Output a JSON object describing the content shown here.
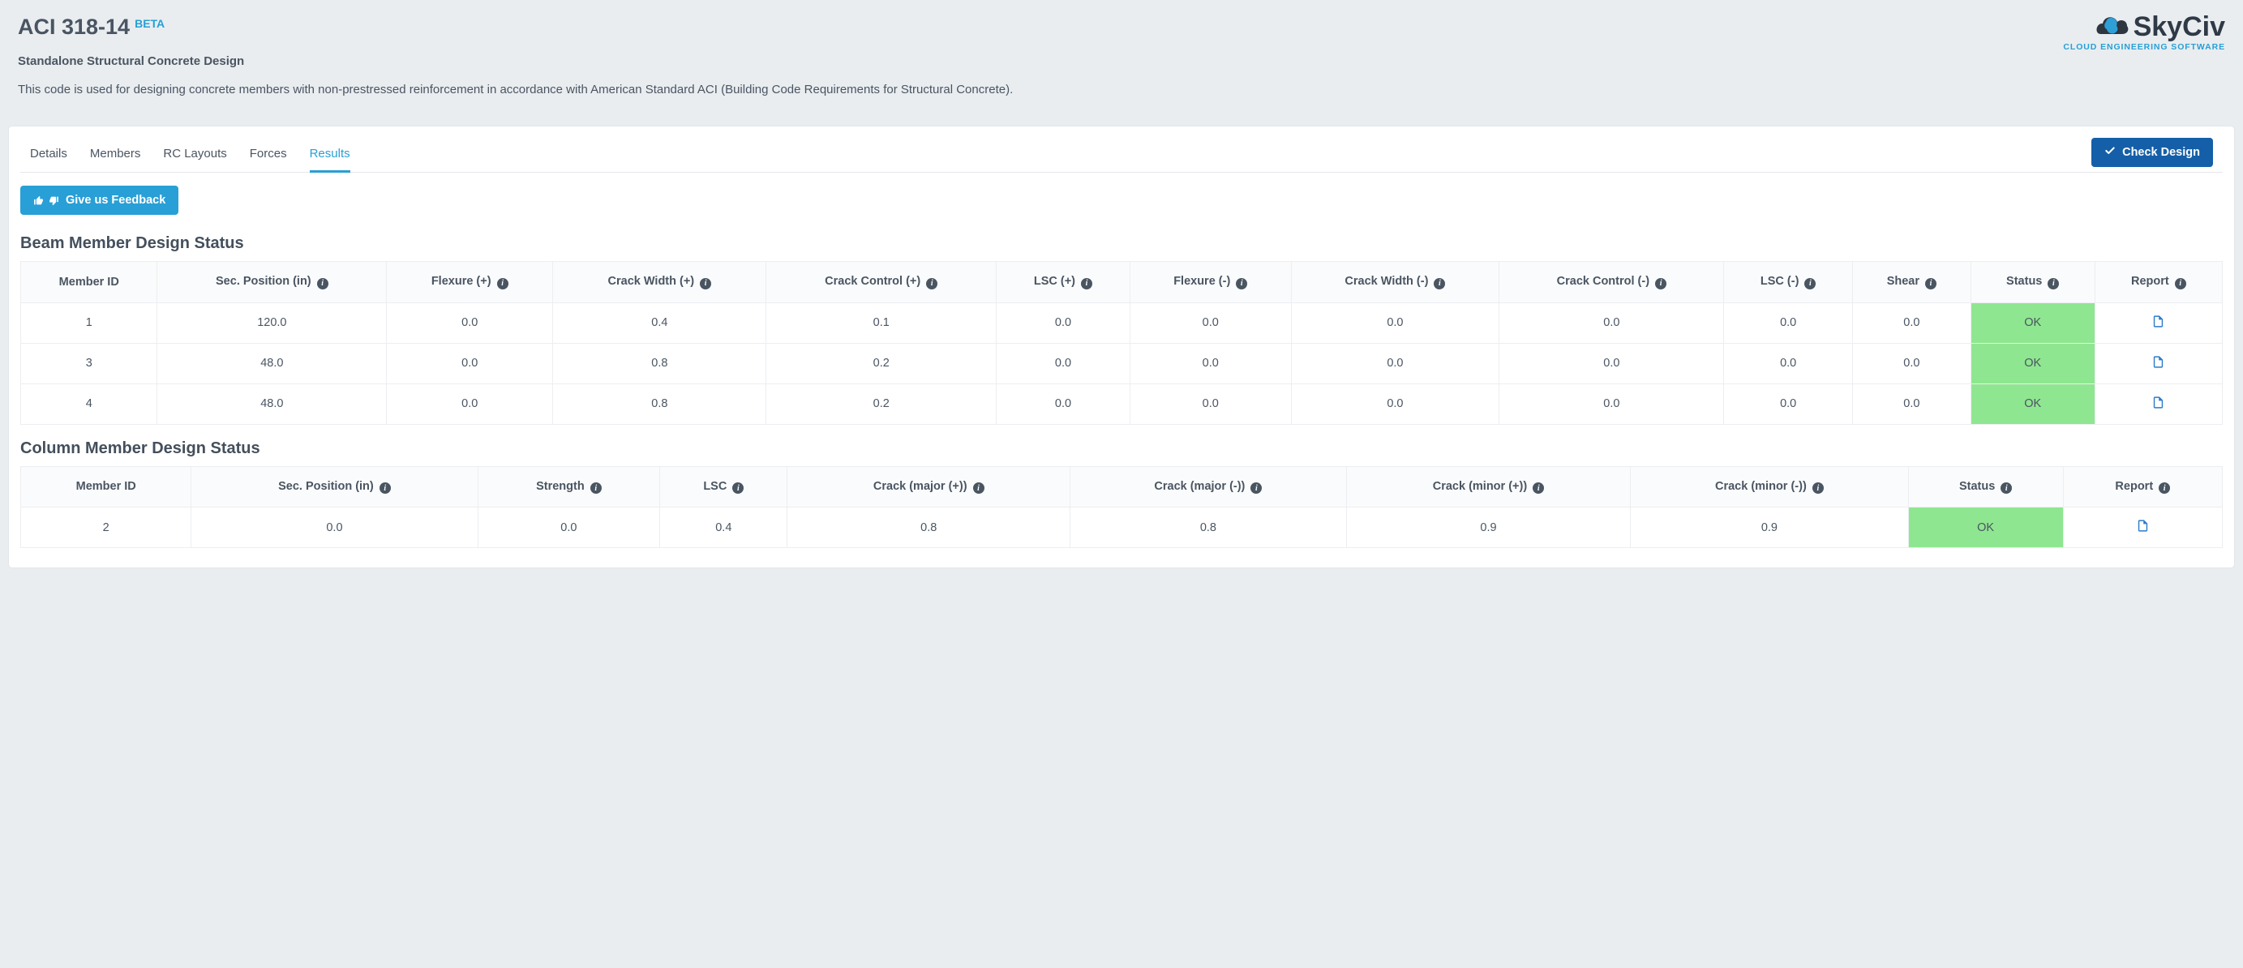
{
  "header": {
    "title": "ACI 318-14",
    "badge": "BETA",
    "subtitle": "Standalone Structural Concrete Design",
    "description": "This code is used for designing concrete members with non-prestressed reinforcement in accordance with American Standard ACI (Building Code Requirements for Structural Concrete).",
    "logo_text": "SkyCiv",
    "logo_subtext": "CLOUD ENGINEERING SOFTWARE"
  },
  "tabs": {
    "items": [
      "Details",
      "Members",
      "RC Layouts",
      "Forces",
      "Results"
    ],
    "active_index": 4
  },
  "buttons": {
    "check_design": "Check Design",
    "feedback": "Give us Feedback"
  },
  "beam_table": {
    "title": "Beam Member Design Status",
    "columns": [
      "Member ID",
      "Sec. Position (in)",
      "Flexure (+)",
      "Crack Width (+)",
      "Crack Control (+)",
      "LSC (+)",
      "Flexure (-)",
      "Crack Width (-)",
      "Crack Control (-)",
      "LSC (-)",
      "Shear",
      "Status",
      "Report"
    ],
    "info_flags": [
      false,
      true,
      true,
      true,
      true,
      true,
      true,
      true,
      true,
      true,
      true,
      true,
      true
    ],
    "rows": [
      {
        "cells": [
          "1",
          "120.0",
          "0.0",
          "0.4",
          "0.1",
          "0.0",
          "0.0",
          "0.0",
          "0.0",
          "0.0",
          "0.0"
        ],
        "status": "OK"
      },
      {
        "cells": [
          "3",
          "48.0",
          "0.0",
          "0.8",
          "0.2",
          "0.0",
          "0.0",
          "0.0",
          "0.0",
          "0.0",
          "0.0"
        ],
        "status": "OK"
      },
      {
        "cells": [
          "4",
          "48.0",
          "0.0",
          "0.8",
          "0.2",
          "0.0",
          "0.0",
          "0.0",
          "0.0",
          "0.0",
          "0.0"
        ],
        "status": "OK"
      }
    ]
  },
  "column_table": {
    "title": "Column Member Design Status",
    "columns": [
      "Member ID",
      "Sec. Position (in)",
      "Strength",
      "LSC",
      "Crack (major (+))",
      "Crack (major (-))",
      "Crack (minor (+))",
      "Crack (minor (-))",
      "Status",
      "Report"
    ],
    "info_flags": [
      false,
      true,
      true,
      true,
      true,
      true,
      true,
      true,
      true,
      true
    ],
    "rows": [
      {
        "cells": [
          "2",
          "0.0",
          "0.0",
          "0.4",
          "0.8",
          "0.8",
          "0.9",
          "0.9"
        ],
        "status": "OK"
      }
    ]
  }
}
